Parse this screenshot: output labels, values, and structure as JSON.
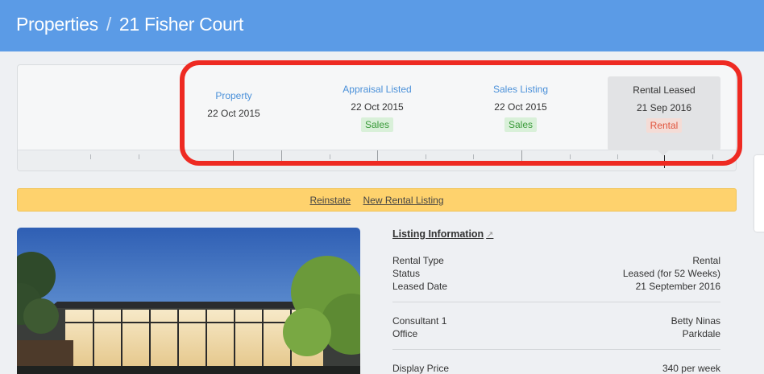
{
  "breadcrumb": {
    "section": "Properties",
    "separator": "/",
    "current": "21 Fisher Court"
  },
  "timeline": {
    "events": [
      {
        "name": "Property",
        "date": "22 Oct 2015",
        "badge": ""
      },
      {
        "name": "Appraisal Listed",
        "date": "22 Oct 2015",
        "badge": "Sales"
      },
      {
        "name": "Sales Listing",
        "date": "22 Oct 2015",
        "badge": "Sales"
      },
      {
        "name": "Rental Leased",
        "date": "21 Sep 2016",
        "badge": "Rental"
      }
    ]
  },
  "actions": {
    "reinstate": "Reinstate",
    "new_rental_listing": "New Rental Listing"
  },
  "listing": {
    "title": "Listing Information",
    "ext_icon": "external-link-icon",
    "rental_type_label": "Rental Type",
    "rental_type": "Rental",
    "status_label": "Status",
    "status": "Leased (for 52 Weeks)",
    "leased_date_label": "Leased Date",
    "leased_date": "21 September 2016",
    "consultant_label": "Consultant 1",
    "consultant": "Betty Ninas",
    "office_label": "Office",
    "office": "Parkdale",
    "display_price_label": "Display Price",
    "display_price": "340 per week"
  },
  "colors": {
    "header": "#5b9be6",
    "highlight": "#ee2a22",
    "action_bar": "#fed26d",
    "link": "#4a90d9"
  }
}
